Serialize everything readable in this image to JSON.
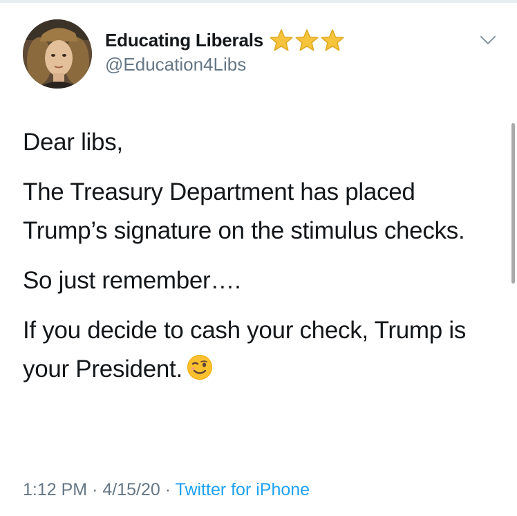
{
  "user": {
    "display_name": "Educating Liberals",
    "handle": "@Education4Libs",
    "badge_icons": [
      "star-icon",
      "star-icon",
      "star-icon"
    ]
  },
  "tweet": {
    "paragraphs": [
      "Dear libs,",
      "The Treasury Department has placed Trump’s signature on the stimulus checks.",
      "So just remember….",
      "If you decide to cash your check, Trump is your President."
    ],
    "trailing_emoji": "winking-face-icon"
  },
  "meta": {
    "time": "1:12 PM",
    "separator": "·",
    "date": "4/15/20",
    "source": "Twitter for iPhone"
  },
  "colors": {
    "text": "#14171a",
    "secondary": "#657786",
    "link": "#1da1f2",
    "star": "#f5c43c"
  }
}
